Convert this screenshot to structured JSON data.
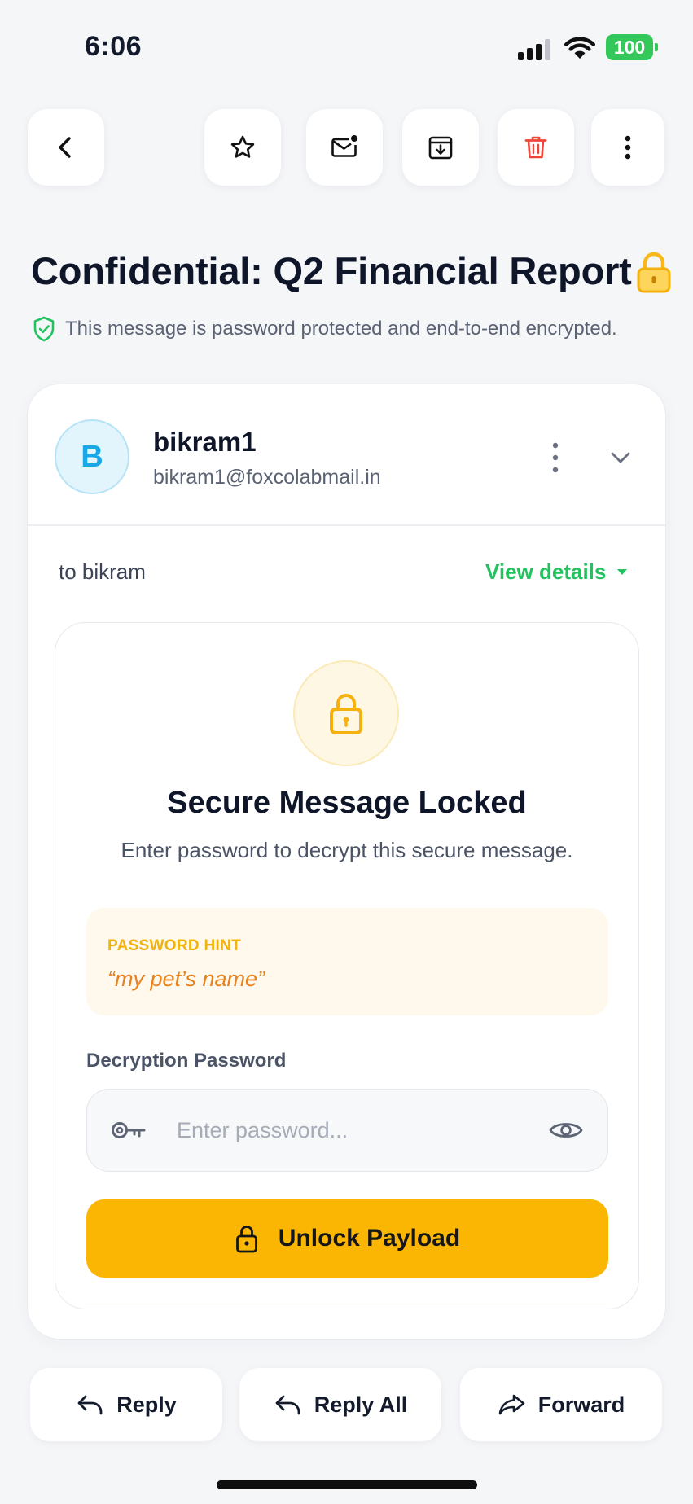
{
  "status_bar": {
    "time": "6:06",
    "battery_level": "100"
  },
  "toolbar": {
    "buttons": [
      "back-icon",
      "star-icon",
      "mark-unread-icon",
      "archive-icon",
      "trash-icon",
      "more-vertical-icon"
    ],
    "delete_color": "#f04438"
  },
  "email": {
    "subject": "Confidential: Q2 Financial Report",
    "encryption_notice": "This message is password protected and end-to-end encrypted.",
    "sender": {
      "avatar_letter": "B",
      "name": "bikram1",
      "email": "bikram1@foxcolabmail.in"
    },
    "recipient_line": "to bikram",
    "view_details_label": "View details"
  },
  "locked": {
    "title": "Secure Message Locked",
    "subtitle": "Enter password to decrypt this secure message.",
    "hint_label": "PASSWORD HINT",
    "hint_value": "“my pet’s name”",
    "password_label": "Decryption Password",
    "password_placeholder": "Enter password...",
    "password_value": "",
    "unlock_label": "Unlock Payload"
  },
  "actions": {
    "reply": "Reply",
    "reply_all": "Reply All",
    "forward": "Forward"
  },
  "colors": {
    "accent_yellow": "#fbb603",
    "accent_green": "#22c35e",
    "avatar_blue": "#1aa7e6",
    "background": "#f5f6f8"
  }
}
